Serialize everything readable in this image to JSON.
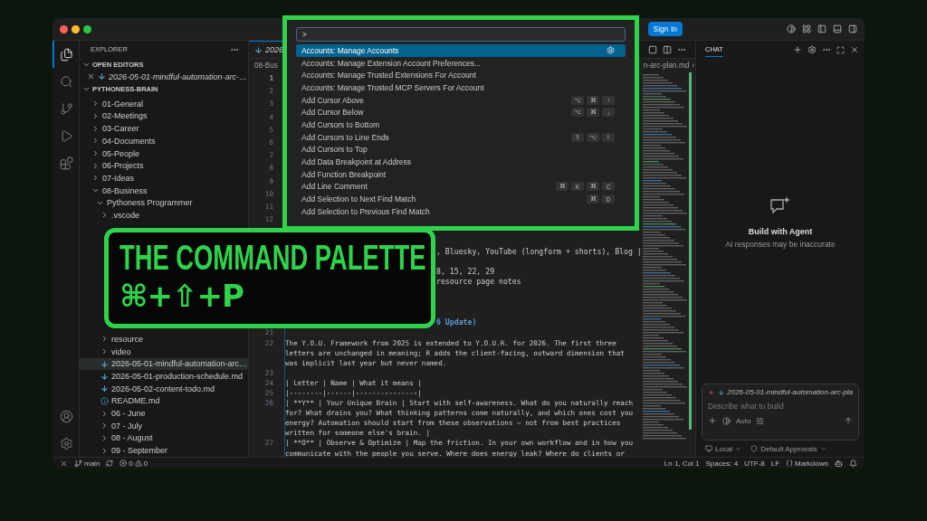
{
  "title_bar": {
    "sign_in": "Sign In"
  },
  "activity_bar": {
    "items": [
      {
        "kind": "explorer",
        "selected": true
      },
      {
        "kind": "search",
        "selected": false
      },
      {
        "kind": "source-control",
        "selected": false
      },
      {
        "kind": "run",
        "selected": false
      },
      {
        "kind": "extensions",
        "selected": false
      }
    ]
  },
  "sidebar": {
    "title": "EXPLORER",
    "open_editors": {
      "title": "OPEN EDITORS",
      "expanded": true,
      "items": [
        {
          "label": "2026-05-01-mindful-automation-arc-…",
          "kind": "markdown"
        }
      ]
    },
    "workspace": {
      "title": "PYTHONESS-BRAIN",
      "expanded": true,
      "items": [
        {
          "label": "01-General",
          "kind": "folder",
          "expanded": false,
          "selected": false
        },
        {
          "label": "02-Meetings",
          "kind": "folder",
          "expanded": false,
          "selected": false
        },
        {
          "label": "03-Career",
          "kind": "folder",
          "expanded": false,
          "selected": false
        },
        {
          "label": "04-Documents",
          "kind": "folder",
          "expanded": false,
          "selected": false
        },
        {
          "label": "05-People",
          "kind": "folder",
          "expanded": false,
          "selected": false
        },
        {
          "label": "06-Projects",
          "kind": "folder",
          "expanded": false,
          "selected": false
        },
        {
          "label": "07-Ideas",
          "kind": "folder",
          "expanded": false,
          "selected": false
        },
        {
          "label": "08-Business",
          "kind": "folder",
          "expanded": true,
          "selected": false,
          "children": [
            {
              "label": "Pythoness Programmer",
              "kind": "folder",
              "expanded": true,
              "selected": false,
              "children": [
                {
                  "label": ".vscode",
                  "kind": "folder",
                  "expanded": false,
                  "selected": false
                },
                {
                  "label": "resource",
                  "kind": "folder",
                  "expanded": false,
                  "selected": false,
                  "covered_above": true
                },
                {
                  "label": "video",
                  "kind": "folder",
                  "expanded": false,
                  "selected": false
                },
                {
                  "label": "2026-05-01-mindful-automation-arc…",
                  "kind": "markdown",
                  "selected": true
                },
                {
                  "label": "2026-05-01-production-schedule.md",
                  "kind": "markdown",
                  "selected": false
                },
                {
                  "label": "2026-05-02-content-todo.md",
                  "kind": "markdown",
                  "selected": false
                },
                {
                  "label": "README.md",
                  "kind": "info",
                  "selected": false
                },
                {
                  "label": "06 - June",
                  "kind": "folder",
                  "expanded": false,
                  "selected": false
                },
                {
                  "label": "07 - July",
                  "kind": "folder",
                  "expanded": false,
                  "selected": false
                },
                {
                  "label": "08 - August",
                  "kind": "folder",
                  "expanded": false,
                  "selected": false
                },
                {
                  "label": "09 - September",
                  "kind": "folder",
                  "expanded": false,
                  "selected": false
                }
              ]
            }
          ]
        }
      ]
    }
  },
  "editor": {
    "tab": "2026",
    "breadcrumb_start": "08-Bus",
    "breadcrumb_end": "n-arc-plan.md",
    "breadcrumb_separator": "›",
    "lines_top": [
      {
        "number": "1"
      },
      {
        "number": "2"
      },
      {
        "number": "3"
      },
      {
        "number": "4"
      },
      {
        "number": "5"
      },
      {
        "number": "6"
      },
      {
        "number": "7"
      },
      {
        "number": "8"
      },
      {
        "number": "9"
      },
      {
        "number": "10"
      },
      {
        "number": "11"
      },
      {
        "number": "12"
      }
    ],
    "fragments": [
      {
        "text": ", Bluesky, YouTube (longform + shorts), Blog |",
        "kind": "plain"
      },
      {
        "text": "8, 15, 22, 29",
        "kind": "plain"
      },
      {
        "text": "resource page notes",
        "kind": "plain"
      },
      {
        "text": "6 Update)",
        "kind": "heading"
      }
    ],
    "lines_bottom": [
      {
        "number": "21"
      },
      {
        "number": "22",
        "text": "The Y.O.U. Framework from 2025 is extended to Y.O.U.R. for 2026. The first three letters are unchanged in meaning; R adds the client-facing, outward dimension that was implicit last year but never named."
      },
      {
        "number": "23"
      },
      {
        "number": "24",
        "text": "| Letter | Name | What it means |"
      },
      {
        "number": "25",
        "text": "|--------|------|---------------|"
      },
      {
        "number": "26",
        "text": "| **Y** | Your Unique Brain | Start with self-awareness. What do you naturally reach for? What drains you? What thinking patterns come naturally, and which ones cost you energy? Automation should start from these observations — not from best practices written for someone else's brain. |"
      },
      {
        "number": "27",
        "text": "| **O** | Observe & Optimize | Map the friction. In your own workflow and in how you communicate with the people you serve. Where does energy leak? Where do clients or"
      }
    ]
  },
  "chat": {
    "tab": "CHAT",
    "title": "Build with Agent",
    "subtitle": "AI responses may be inaccurate",
    "attachment": "2026-05-01-mindful-automation-arc-pla",
    "placeholder": "Describe what to build",
    "mode": "Auto",
    "target": "Local",
    "approvals": "Default Approvals"
  },
  "status_bar": {
    "branch": "main",
    "errors": "0",
    "warnings": "0",
    "items": [
      "Ln 1, Col 1",
      "Spaces: 4",
      "UTF-8",
      "LF"
    ],
    "language": "Markdown"
  },
  "command_palette": {
    "query": ">",
    "items": [
      {
        "label": "Accounts: Manage Accounts",
        "selected": true
      },
      {
        "label": "Accounts: Manage Extension Account Preferences...",
        "selected": false
      },
      {
        "label": "Accounts: Manage Trusted Extensions For Account",
        "selected": false
      },
      {
        "label": "Accounts: Manage Trusted MCP Servers For Account",
        "selected": false
      },
      {
        "label": "Add Cursor Above",
        "selected": false,
        "keys": [
          "⌥",
          "⌘",
          "↑"
        ]
      },
      {
        "label": "Add Cursor Below",
        "selected": false,
        "keys": [
          "⌥",
          "⌘",
          "↓"
        ]
      },
      {
        "label": "Add Cursors to Bottom",
        "selected": false
      },
      {
        "label": "Add Cursors to Line Ends",
        "selected": false,
        "keys": [
          "⇧",
          "⌥",
          "I"
        ]
      },
      {
        "label": "Add Cursors to Top",
        "selected": false
      },
      {
        "label": "Add Data Breakpoint at Address",
        "selected": false
      },
      {
        "label": "Add Function Breakpoint",
        "selected": false
      },
      {
        "label": "Add Line Comment",
        "selected": false,
        "keys": [
          "⌘",
          "K",
          "⌘",
          "C"
        ]
      },
      {
        "label": "Add Selection to Next Find Match",
        "selected": false,
        "keys": [
          "⌘",
          "D"
        ]
      },
      {
        "label": "Add Selection to Previous Find Match",
        "selected": false
      }
    ]
  },
  "banner": {
    "title": "THE COMMAND PALETTE",
    "shortcut": "⌘+⇧+P"
  }
}
